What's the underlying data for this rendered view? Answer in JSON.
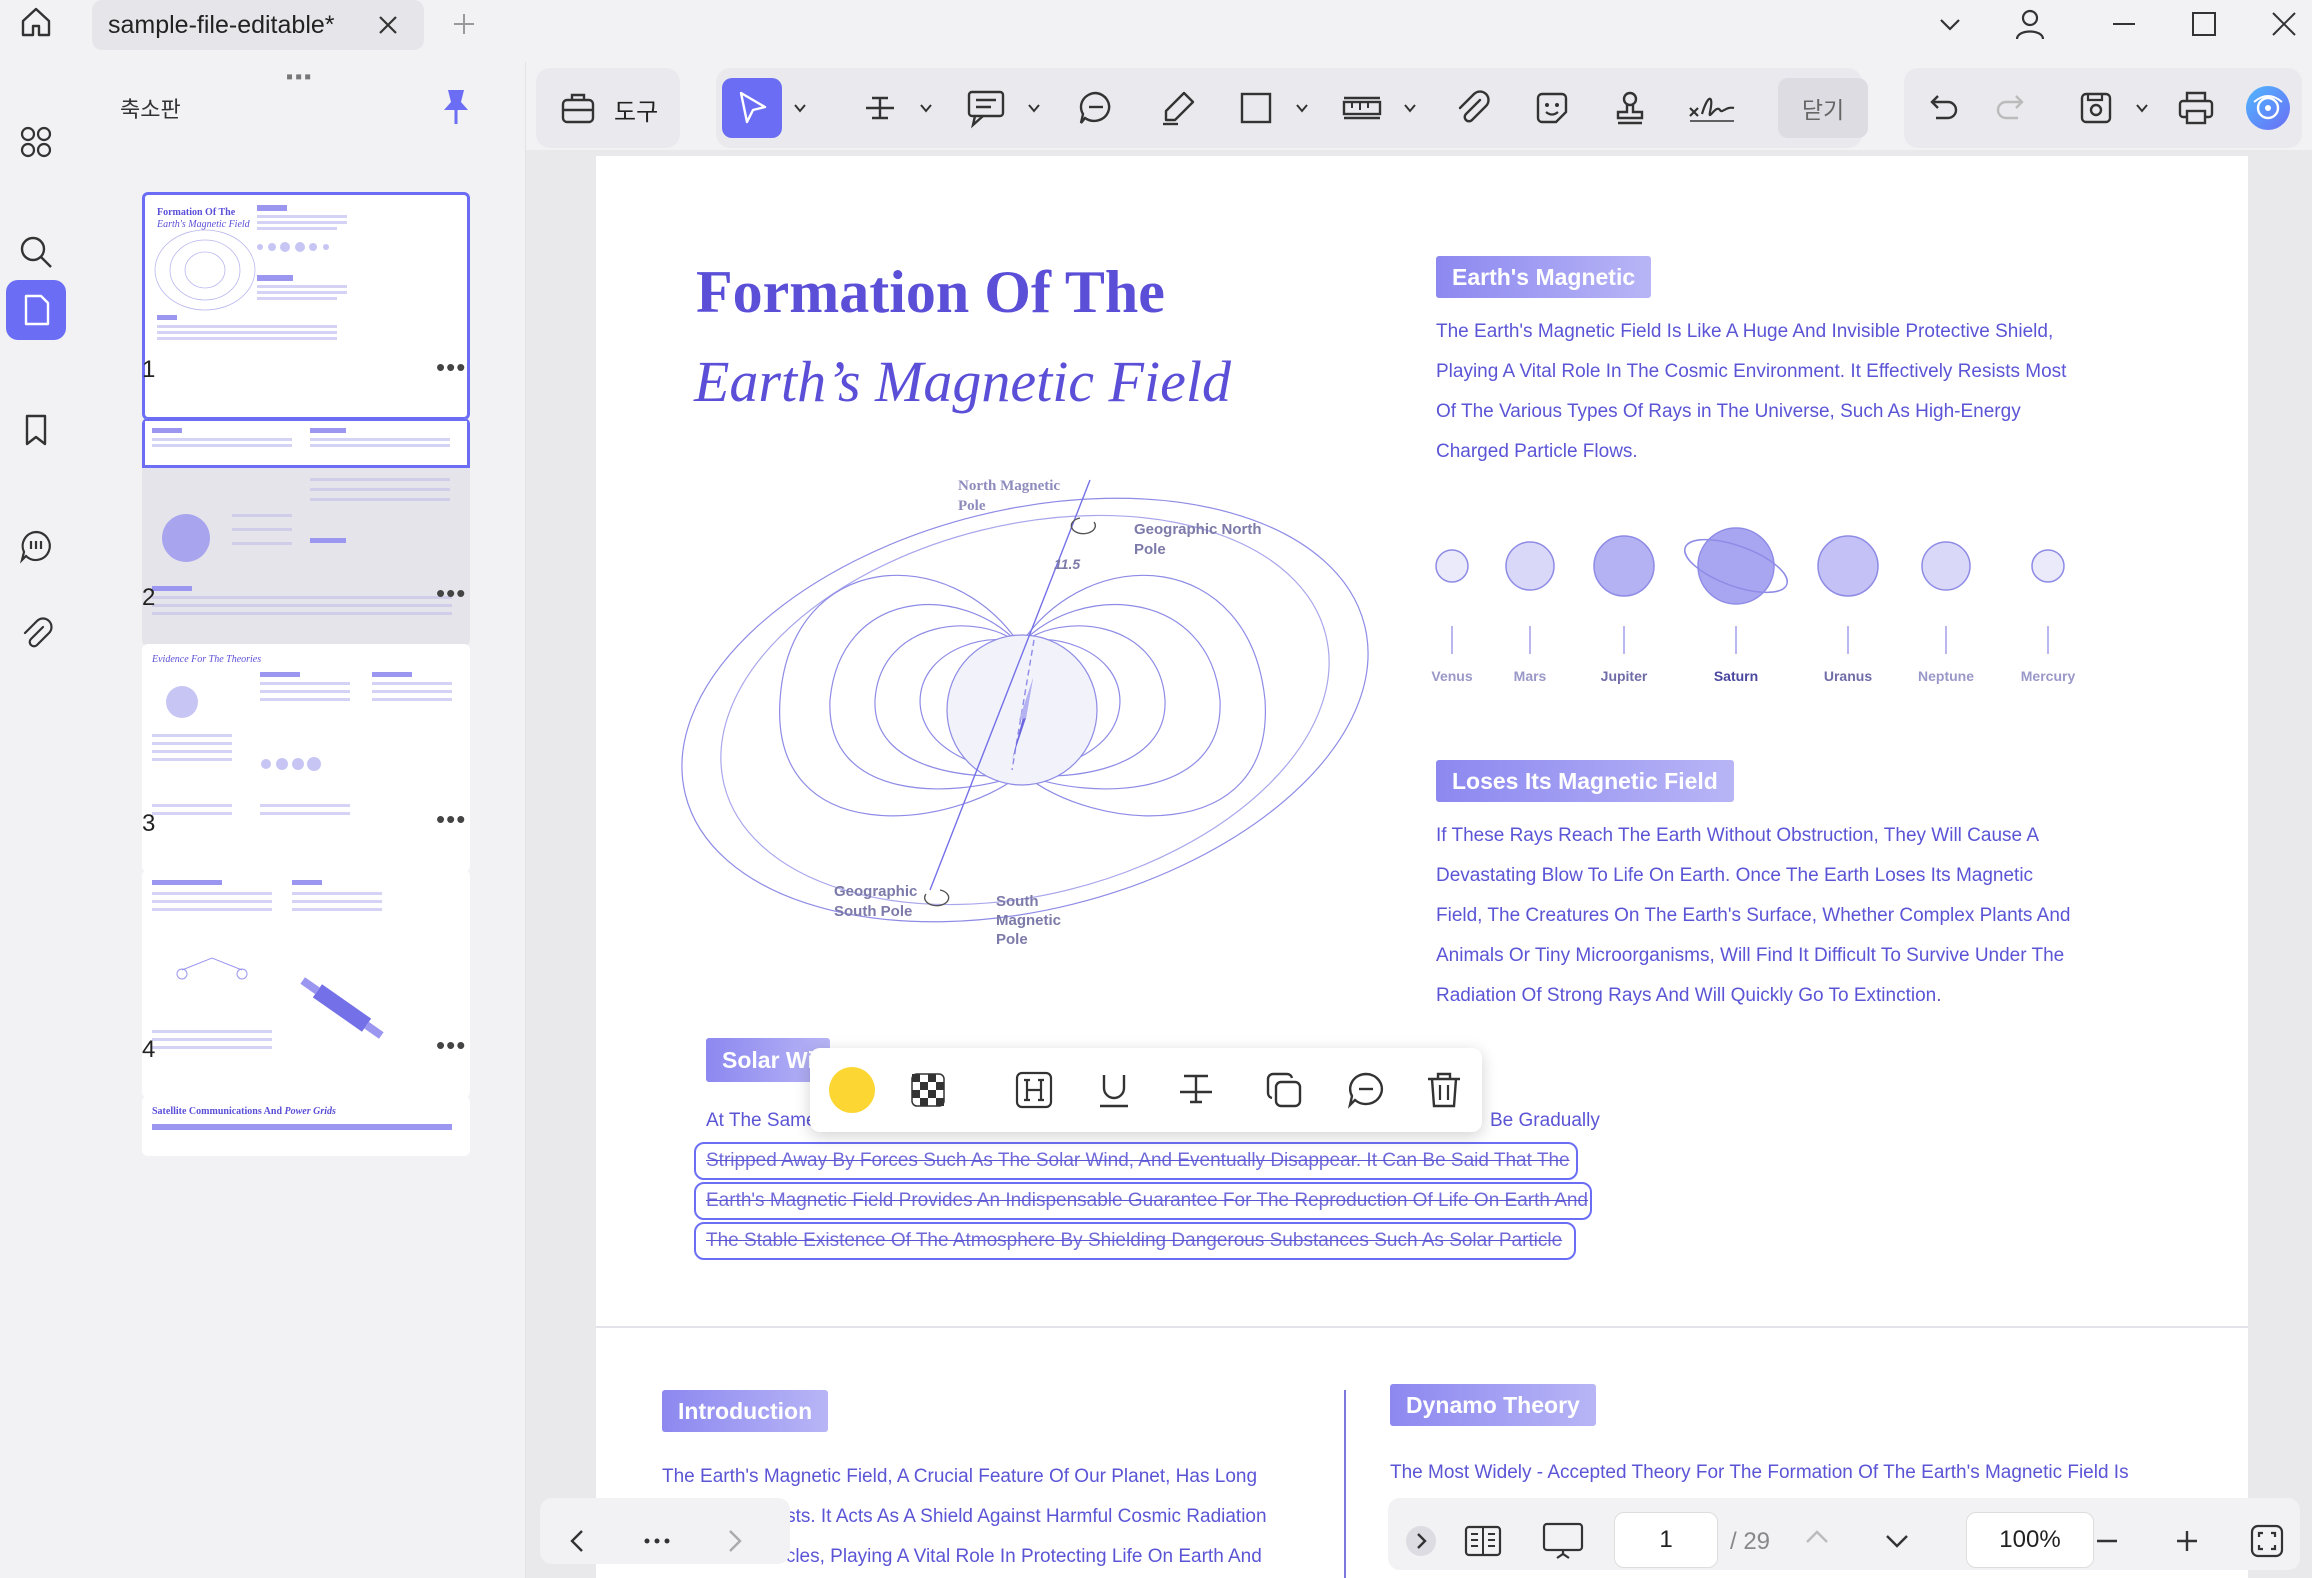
{
  "tab": {
    "title": "sample-file-editable*"
  },
  "panel": {
    "title": "축소판"
  },
  "thumbnails": [
    {
      "num": "1",
      "caption": "Formation Of The Earth's Magnetic Field"
    },
    {
      "num": "2",
      "caption": ""
    },
    {
      "num": "3",
      "caption": "Evidence For The Theories"
    },
    {
      "num": "4",
      "caption": ""
    },
    {
      "num": "",
      "caption": "Satellite Communications And Power Grids"
    }
  ],
  "toolbar": {
    "tools_label": "도구",
    "close_label": "닫기"
  },
  "doc": {
    "title_line1": "Formation Of The",
    "title_line2": "Earth’s Magnetic Field",
    "diagram": {
      "north_magnetic_pole": "North Magnetic Pole",
      "geo_north": "Geographic North Pole",
      "geo_south": "Geographic South Pole",
      "south_magnetic_pole": "South Magnetic Pole",
      "angle": "11.5"
    },
    "earths_magnetic": {
      "heading": "Earth's Magnetic",
      "lines": [
        "The Earth's Magnetic Field Is Like A Huge And Invisible Protective Shield,",
        "Playing A Vital Role In The Cosmic Environment. It Effectively Resists Most",
        "Of The Various Types Of Rays in The Universe, Such As High-Energy",
        "Charged Particle Flows."
      ]
    },
    "planets": [
      "Venus",
      "Mars",
      "Jupiter",
      "Saturn",
      "Uranus",
      "Neptune",
      "Mercury"
    ],
    "loses": {
      "heading": "Loses Its Magnetic Field",
      "lines": [
        "If These Rays Reach The Earth Without Obstruction, They Will Cause A",
        "Devastating Blow To Life On Earth. Once The Earth Loses Its Magnetic",
        "Field, The Creatures On The Earth's Surface, Whether Complex Plants And",
        "Animals Or Tiny Microorganisms, Will Find It Difficult To Survive Under The",
        "Radiation Of Strong Rays And Will Quickly Go To Extinction."
      ]
    },
    "solar": {
      "heading": "Solar Wi",
      "line0_start": "At The Same",
      "line0_end": "Be Gradually",
      "struck": [
        "Stripped Away By Forces Such As The Solar Wind, And Eventually Disappear. It Can Be Said That The",
        "Earth's Magnetic Field Provides An Indispensable Guarantee For The Reproduction Of Life On Earth And",
        "The Stable Existence Of The Atmosphere By Shielding Dangerous Substances Such As Solar Particle"
      ]
    },
    "intro": {
      "heading": "Introduction",
      "lines": [
        "The Earth's Magnetic Field, A Crucial Feature Of Our Planet, Has Long",
        "ntists. It Acts As A Shield Against Harmful Cosmic Radiation",
        "rticles, Playing A Vital Role In Protecting Life On Earth And"
      ]
    },
    "dynamo": {
      "heading": "Dynamo Theory",
      "line": "The Most Widely - Accepted Theory For The Formation Of The Earth's Magnetic Field Is"
    }
  },
  "nav": {
    "page": "1",
    "total": "/ 29",
    "zoom": "100%"
  },
  "colors": {
    "accent": "#6b6ef5",
    "text_purple": "#5b55d6",
    "highlight_yellow": "#fcd734"
  }
}
